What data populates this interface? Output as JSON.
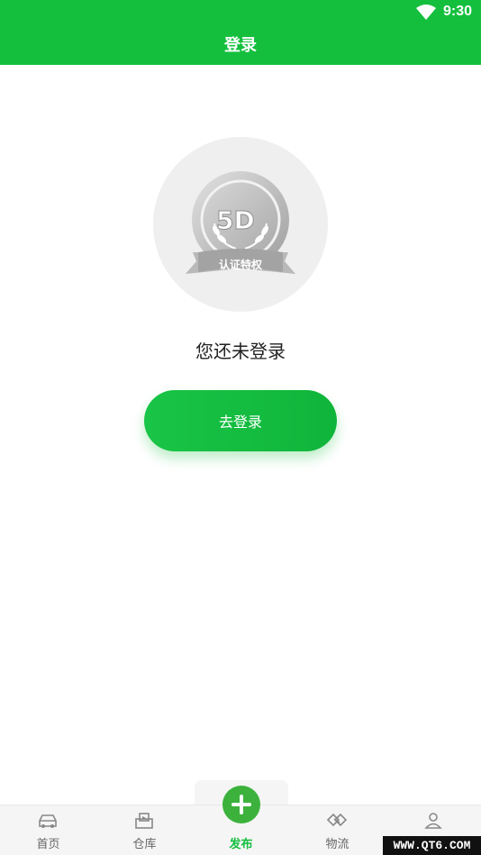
{
  "status_bar": {
    "time": "9:30",
    "wifi_icon": "wifi-icon"
  },
  "header": {
    "title": "登录"
  },
  "badge": {
    "icon": "5d-certification-badge-icon",
    "logo_text": "5D",
    "ribbon_text": "认证特权"
  },
  "main": {
    "message": "您还未登录",
    "login_button": "去登录"
  },
  "bottom_nav": {
    "items": [
      {
        "label": "首页",
        "icon": "car-icon",
        "active": false
      },
      {
        "label": "仓库",
        "icon": "warehouse-icon",
        "active": false
      },
      {
        "label": "发布",
        "icon": "plus-icon",
        "active": true
      },
      {
        "label": "物流",
        "icon": "handshake-icon",
        "active": false
      },
      {
        "label": "",
        "icon": "user-icon",
        "active": false
      }
    ]
  },
  "watermark": "WWW.QT6.COM",
  "colors": {
    "brand": "#14bf3d",
    "fab": "#3cb23c"
  }
}
